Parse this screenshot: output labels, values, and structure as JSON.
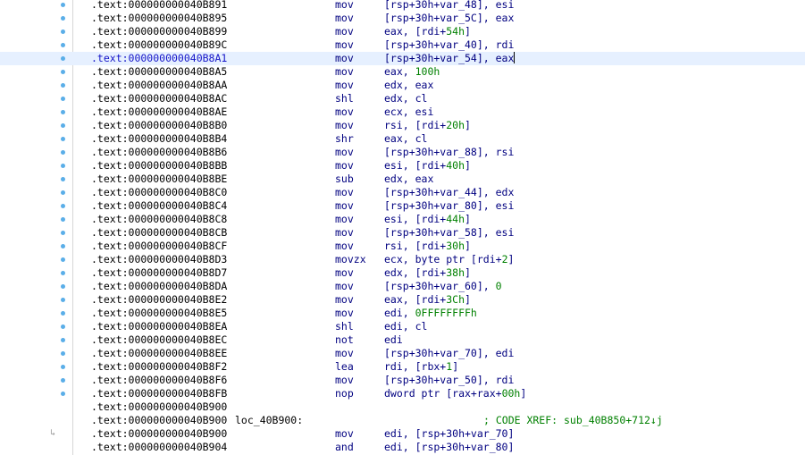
{
  "colors": {
    "background": "#ffffff",
    "address": "#000000",
    "current_address": "#1414c8",
    "mnemonic": "#000080",
    "number": "#008000",
    "comment": "#008000",
    "gutter_dot": "#5aaee8",
    "current_line": "#e6f0ff"
  },
  "current_line_index": 4,
  "lines": [
    {
      "address": ".text:000000000040B891",
      "label": "",
      "mnemonic": "mov",
      "operands": [
        {
          "t": "[rsp+30h+var_48], esi"
        }
      ],
      "dot": true
    },
    {
      "address": ".text:000000000040B895",
      "label": "",
      "mnemonic": "mov",
      "operands": [
        {
          "t": "[rsp+30h+var_5C], eax"
        }
      ],
      "dot": true
    },
    {
      "address": ".text:000000000040B899",
      "label": "",
      "mnemonic": "mov",
      "operands": [
        {
          "t": "eax, [rdi+"
        },
        {
          "t": "54h",
          "n": true
        },
        {
          "t": "]"
        }
      ],
      "dot": true
    },
    {
      "address": ".text:000000000040B89C",
      "label": "",
      "mnemonic": "mov",
      "operands": [
        {
          "t": "[rsp+30h+var_40], rdi"
        }
      ],
      "dot": true
    },
    {
      "address": ".text:000000000040B8A1",
      "label": "",
      "mnemonic": "mov",
      "operands": [
        {
          "t": "[rsp+30h+var_54], eax"
        }
      ],
      "dot": true,
      "caret": true
    },
    {
      "address": ".text:000000000040B8A5",
      "label": "",
      "mnemonic": "mov",
      "operands": [
        {
          "t": "eax, "
        },
        {
          "t": "100h",
          "n": true
        }
      ],
      "dot": true
    },
    {
      "address": ".text:000000000040B8AA",
      "label": "",
      "mnemonic": "mov",
      "operands": [
        {
          "t": "edx, eax"
        }
      ],
      "dot": true
    },
    {
      "address": ".text:000000000040B8AC",
      "label": "",
      "mnemonic": "shl",
      "operands": [
        {
          "t": "edx, cl"
        }
      ],
      "dot": true
    },
    {
      "address": ".text:000000000040B8AE",
      "label": "",
      "mnemonic": "mov",
      "operands": [
        {
          "t": "ecx, esi"
        }
      ],
      "dot": true
    },
    {
      "address": ".text:000000000040B8B0",
      "label": "",
      "mnemonic": "mov",
      "operands": [
        {
          "t": "rsi, [rdi+"
        },
        {
          "t": "20h",
          "n": true
        },
        {
          "t": "]"
        }
      ],
      "dot": true
    },
    {
      "address": ".text:000000000040B8B4",
      "label": "",
      "mnemonic": "shr",
      "operands": [
        {
          "t": "eax, cl"
        }
      ],
      "dot": true
    },
    {
      "address": ".text:000000000040B8B6",
      "label": "",
      "mnemonic": "mov",
      "operands": [
        {
          "t": "[rsp+30h+var_88], rsi"
        }
      ],
      "dot": true
    },
    {
      "address": ".text:000000000040B8BB",
      "label": "",
      "mnemonic": "mov",
      "operands": [
        {
          "t": "esi, [rdi+"
        },
        {
          "t": "40h",
          "n": true
        },
        {
          "t": "]"
        }
      ],
      "dot": true
    },
    {
      "address": ".text:000000000040B8BE",
      "label": "",
      "mnemonic": "sub",
      "operands": [
        {
          "t": "edx, eax"
        }
      ],
      "dot": true
    },
    {
      "address": ".text:000000000040B8C0",
      "label": "",
      "mnemonic": "mov",
      "operands": [
        {
          "t": "[rsp+30h+var_44], edx"
        }
      ],
      "dot": true
    },
    {
      "address": ".text:000000000040B8C4",
      "label": "",
      "mnemonic": "mov",
      "operands": [
        {
          "t": "[rsp+30h+var_80], esi"
        }
      ],
      "dot": true
    },
    {
      "address": ".text:000000000040B8C8",
      "label": "",
      "mnemonic": "mov",
      "operands": [
        {
          "t": "esi, [rdi+"
        },
        {
          "t": "44h",
          "n": true
        },
        {
          "t": "]"
        }
      ],
      "dot": true
    },
    {
      "address": ".text:000000000040B8CB",
      "label": "",
      "mnemonic": "mov",
      "operands": [
        {
          "t": "[rsp+30h+var_58], esi"
        }
      ],
      "dot": true
    },
    {
      "address": ".text:000000000040B8CF",
      "label": "",
      "mnemonic": "mov",
      "operands": [
        {
          "t": "rsi, [rdi+"
        },
        {
          "t": "30h",
          "n": true
        },
        {
          "t": "]"
        }
      ],
      "dot": true
    },
    {
      "address": ".text:000000000040B8D3",
      "label": "",
      "mnemonic": "movzx",
      "operands": [
        {
          "t": "ecx, byte ptr [rdi+"
        },
        {
          "t": "2",
          "n": true
        },
        {
          "t": "]"
        }
      ],
      "dot": true
    },
    {
      "address": ".text:000000000040B8D7",
      "label": "",
      "mnemonic": "mov",
      "operands": [
        {
          "t": "edx, [rdi+"
        },
        {
          "t": "38h",
          "n": true
        },
        {
          "t": "]"
        }
      ],
      "dot": true
    },
    {
      "address": ".text:000000000040B8DA",
      "label": "",
      "mnemonic": "mov",
      "operands": [
        {
          "t": "[rsp+30h+var_60], "
        },
        {
          "t": "0",
          "n": true
        }
      ],
      "dot": true
    },
    {
      "address": ".text:000000000040B8E2",
      "label": "",
      "mnemonic": "mov",
      "operands": [
        {
          "t": "eax, [rdi+"
        },
        {
          "t": "3Ch",
          "n": true
        },
        {
          "t": "]"
        }
      ],
      "dot": true
    },
    {
      "address": ".text:000000000040B8E5",
      "label": "",
      "mnemonic": "mov",
      "operands": [
        {
          "t": "edi, "
        },
        {
          "t": "0FFFFFFFFh",
          "n": true
        }
      ],
      "dot": true
    },
    {
      "address": ".text:000000000040B8EA",
      "label": "",
      "mnemonic": "shl",
      "operands": [
        {
          "t": "edi, cl"
        }
      ],
      "dot": true
    },
    {
      "address": ".text:000000000040B8EC",
      "label": "",
      "mnemonic": "not",
      "operands": [
        {
          "t": "edi"
        }
      ],
      "dot": true
    },
    {
      "address": ".text:000000000040B8EE",
      "label": "",
      "mnemonic": "mov",
      "operands": [
        {
          "t": "[rsp+30h+var_70], edi"
        }
      ],
      "dot": true
    },
    {
      "address": ".text:000000000040B8F2",
      "label": "",
      "mnemonic": "lea",
      "operands": [
        {
          "t": "rdi, [rbx+"
        },
        {
          "t": "1",
          "n": true
        },
        {
          "t": "]"
        }
      ],
      "dot": true
    },
    {
      "address": ".text:000000000040B8F6",
      "label": "",
      "mnemonic": "mov",
      "operands": [
        {
          "t": "[rsp+30h+var_50], rdi"
        }
      ],
      "dot": true
    },
    {
      "address": ".text:000000000040B8FB",
      "label": "",
      "mnemonic": "nop",
      "operands": [
        {
          "t": "dword ptr [rax+rax+"
        },
        {
          "t": "00h",
          "n": true
        },
        {
          "t": "]"
        }
      ],
      "dot": true
    },
    {
      "address": ".text:000000000040B900",
      "label": "",
      "mnemonic": "",
      "operands": [],
      "dot": false
    },
    {
      "address": ".text:000000000040B900",
      "label": "loc_40B900:",
      "mnemonic": "",
      "operands": [],
      "comment": "; CODE XREF: sub_40B850+712↓j",
      "dot": false
    },
    {
      "address": ".text:000000000040B900",
      "label": "",
      "mnemonic": "mov",
      "operands": [
        {
          "t": "edi, [rsp+30h+var_70]"
        }
      ],
      "dot": false,
      "arrow": true
    },
    {
      "address": ".text:000000000040B904",
      "label": "",
      "mnemonic": "and",
      "operands": [
        {
          "t": "edi, [rsp+30h+var_80]"
        }
      ],
      "dot": false
    }
  ]
}
